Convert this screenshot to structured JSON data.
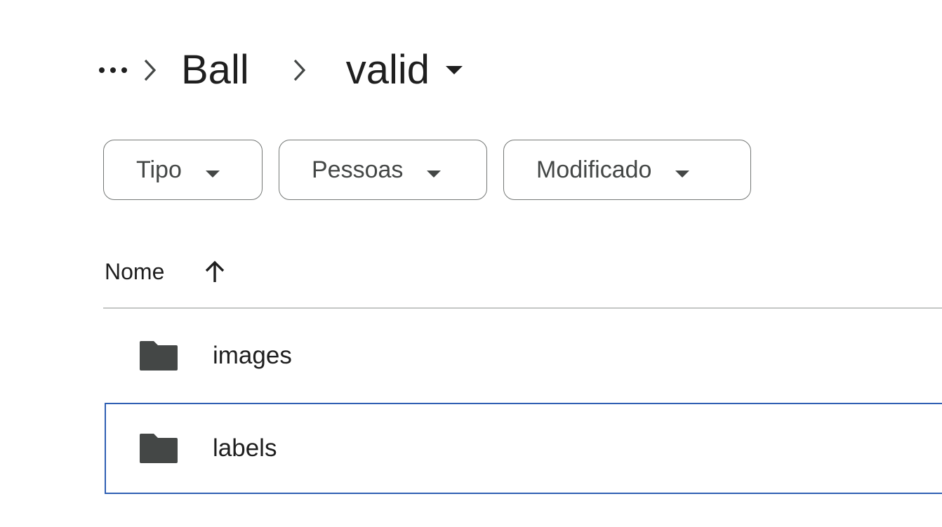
{
  "breadcrumb": {
    "more_icon": "more-horiz-icon",
    "separator_icon": "chevron-right-icon",
    "parent": "Ball",
    "current": "valid",
    "current_caret_icon": "arrow-drop-down-icon"
  },
  "filters": [
    {
      "label": "Tipo",
      "icon": "arrow-drop-down-icon"
    },
    {
      "label": "Pessoas",
      "icon": "arrow-drop-down-icon"
    },
    {
      "label": "Modificado",
      "icon": "arrow-drop-down-icon"
    }
  ],
  "list": {
    "header": {
      "name_label": "Nome",
      "sort_icon": "arrow-upward-icon"
    },
    "items": [
      {
        "name": "images",
        "icon": "folder-icon",
        "selected": false
      },
      {
        "name": "labels",
        "icon": "folder-icon",
        "selected": true
      }
    ]
  },
  "colors": {
    "text": "#1f1f1f",
    "chip_border": "#747775",
    "divider": "#c4c7c5",
    "selection_border": "#2f5fb3",
    "folder": "#444746"
  }
}
